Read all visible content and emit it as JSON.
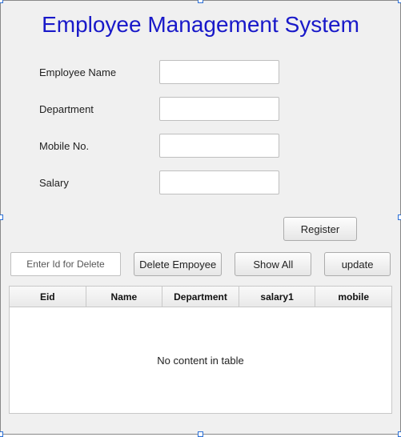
{
  "title": "Employee Management System",
  "form": {
    "employee_name": {
      "label": "Employee Name",
      "value": ""
    },
    "department": {
      "label": "Department",
      "value": ""
    },
    "mobile": {
      "label": "Mobile No.",
      "value": ""
    },
    "salary": {
      "label": "Salary",
      "value": ""
    }
  },
  "buttons": {
    "register": "Register",
    "delete_id_placeholder": "Enter Id for Delete",
    "delete": "Delete Empoyee",
    "show_all": "Show All",
    "update": "update"
  },
  "table": {
    "columns": [
      "Eid",
      "Name",
      "Department",
      "salary1",
      "mobile"
    ],
    "empty_text": "No content in table"
  }
}
